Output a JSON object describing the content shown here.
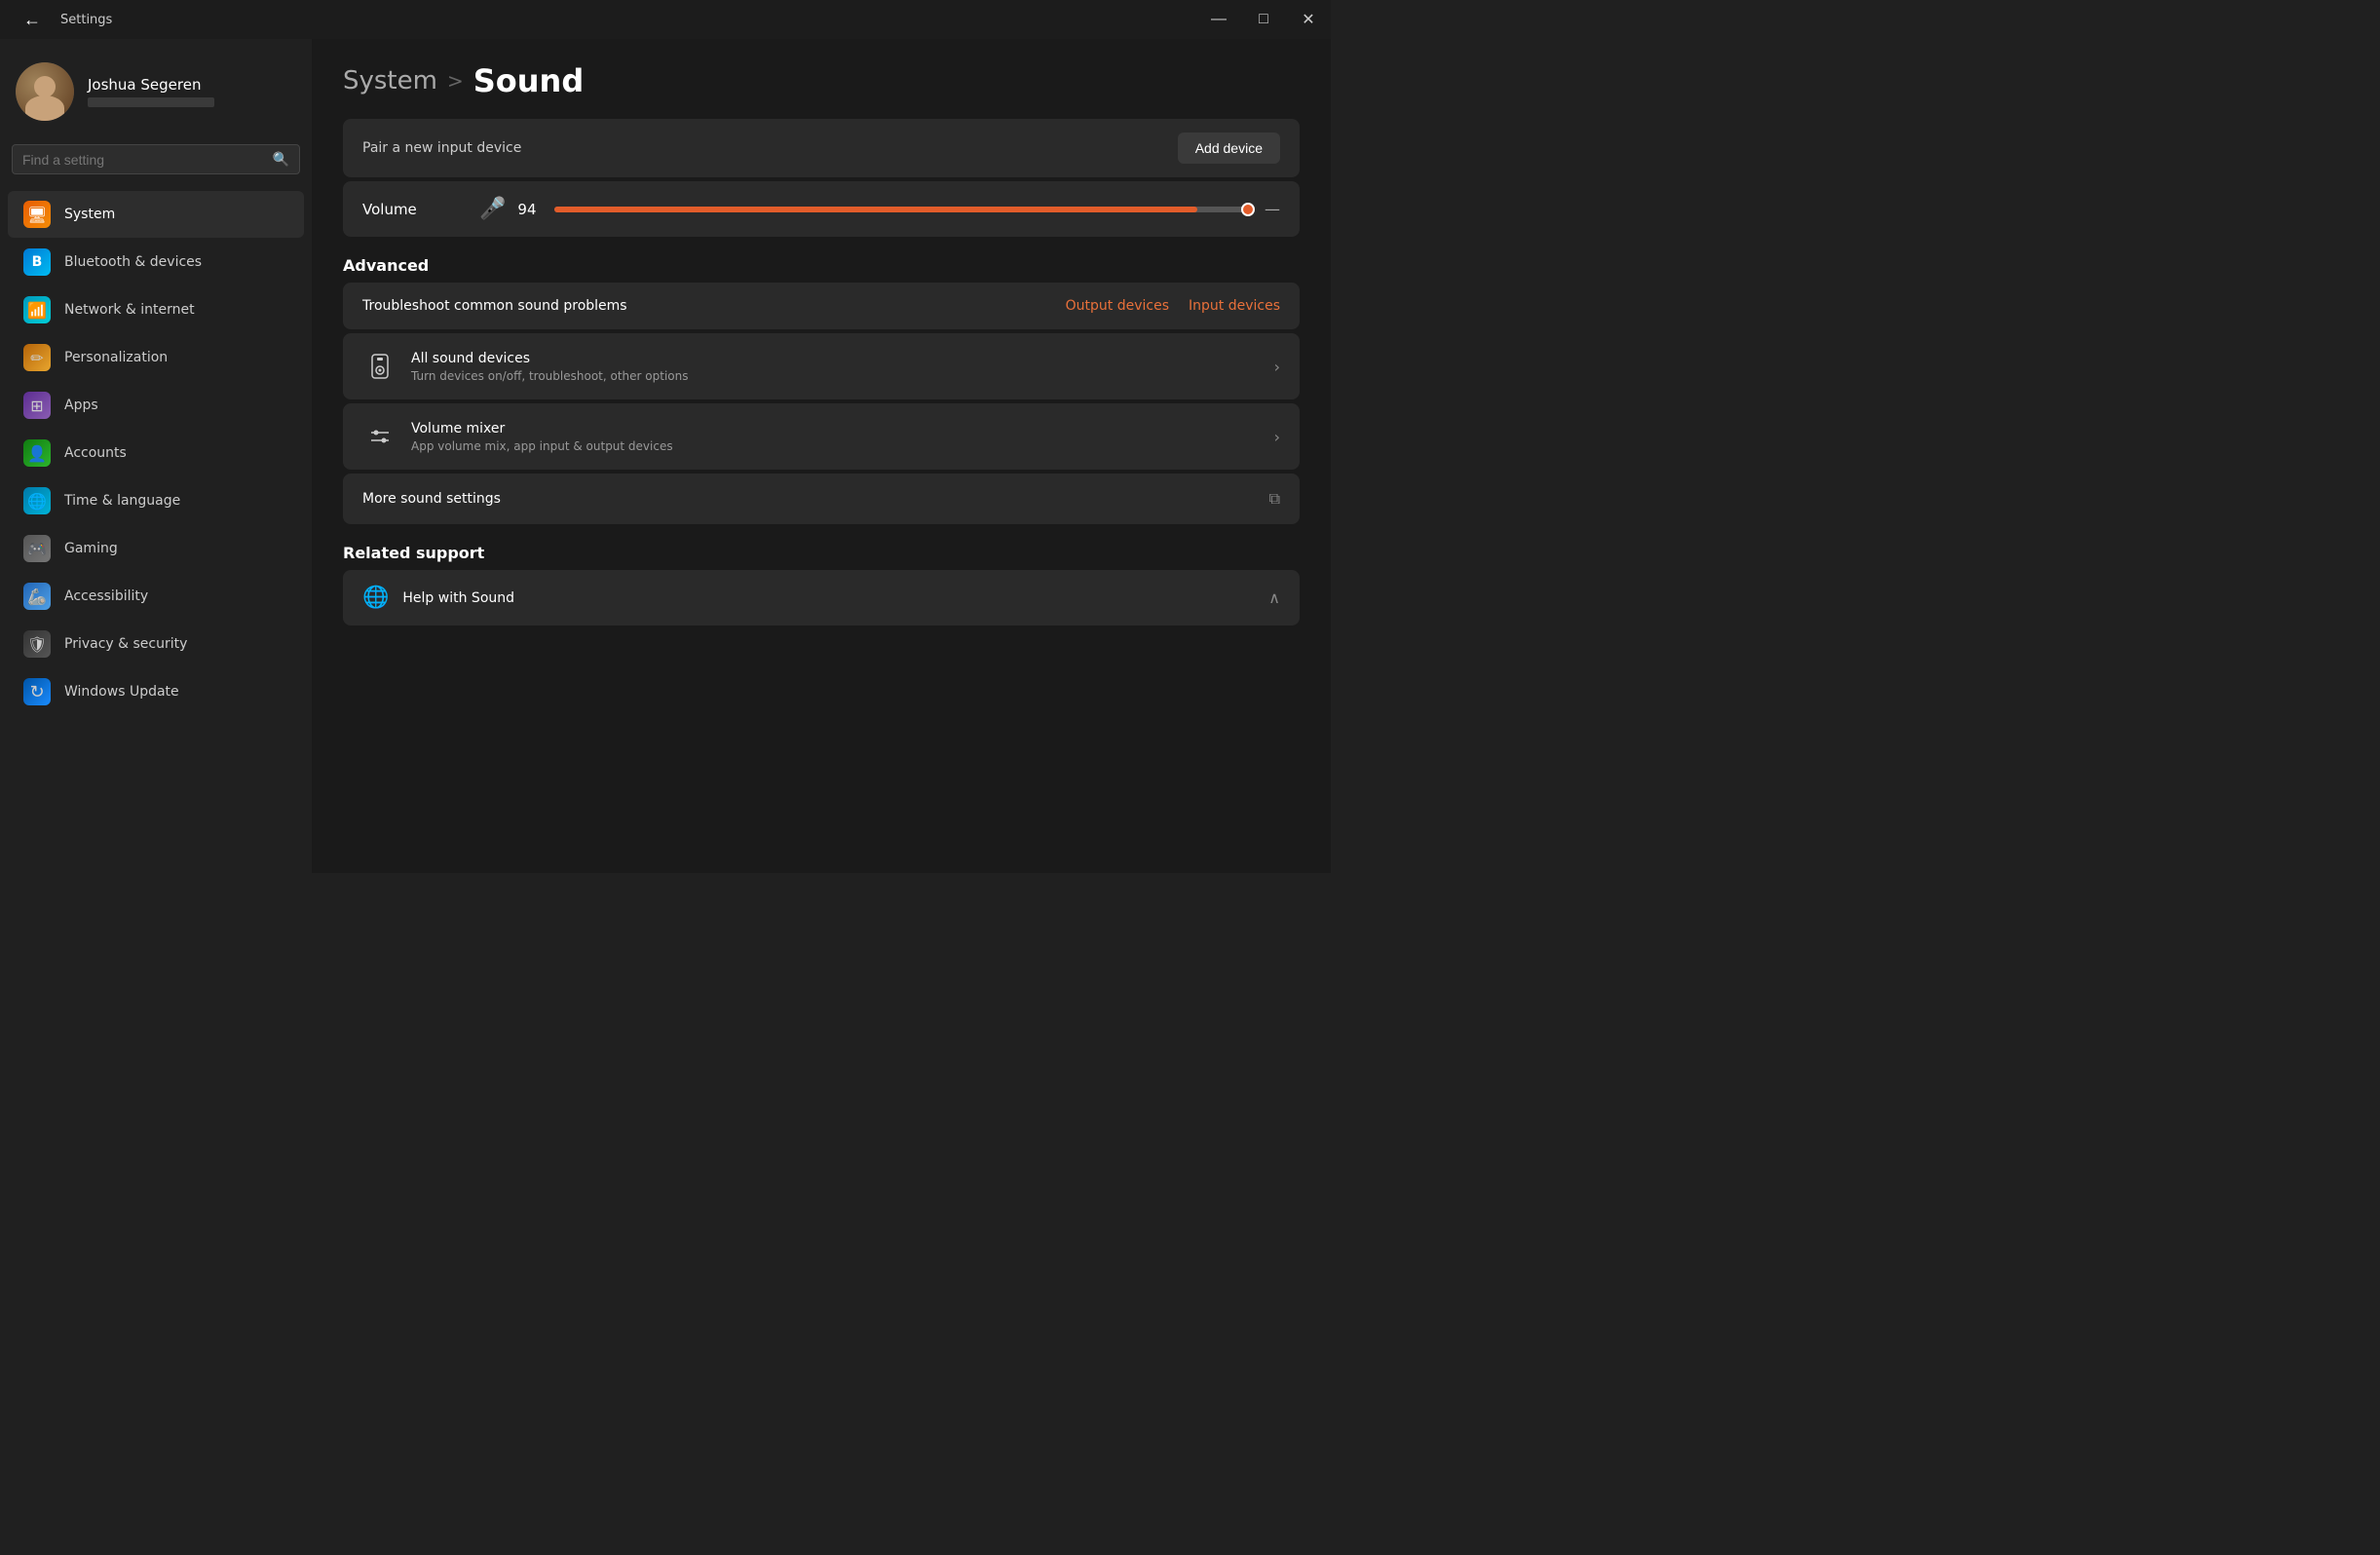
{
  "window": {
    "title": "Settings",
    "controls": {
      "minimize": "—",
      "maximize": "□",
      "close": "✕"
    }
  },
  "sidebar": {
    "user": {
      "name": "Joshua Segeren",
      "email_placeholder": "●●●●●●●●●●●●"
    },
    "search": {
      "placeholder": "Find a setting"
    },
    "nav_items": [
      {
        "id": "system",
        "label": "System",
        "icon": "🖥",
        "icon_class": "orange",
        "active": true
      },
      {
        "id": "bluetooth",
        "label": "Bluetooth & devices",
        "icon": "✦",
        "icon_class": "blue",
        "active": false
      },
      {
        "id": "network",
        "label": "Network & internet",
        "icon": "📶",
        "icon_class": "cyan",
        "active": false
      },
      {
        "id": "personalization",
        "label": "Personalization",
        "icon": "✏",
        "icon_class": "yellow",
        "active": false
      },
      {
        "id": "apps",
        "label": "Apps",
        "icon": "⊞",
        "icon_class": "purple",
        "active": false
      },
      {
        "id": "accounts",
        "label": "Accounts",
        "icon": "👤",
        "icon_class": "green",
        "active": false
      },
      {
        "id": "time",
        "label": "Time & language",
        "icon": "🌐",
        "icon_class": "teal",
        "active": false
      },
      {
        "id": "gaming",
        "label": "Gaming",
        "icon": "🎮",
        "icon_class": "game",
        "active": false
      },
      {
        "id": "accessibility",
        "label": "Accessibility",
        "icon": "♿",
        "icon_class": "access",
        "active": false
      },
      {
        "id": "privacy",
        "label": "Privacy & security",
        "icon": "🛡",
        "icon_class": "shield",
        "active": false
      },
      {
        "id": "update",
        "label": "Windows Update",
        "icon": "↻",
        "icon_class": "update",
        "active": false
      }
    ]
  },
  "content": {
    "breadcrumb_parent": "System",
    "breadcrumb_sep": ">",
    "breadcrumb_current": "Sound",
    "pair_device": {
      "label": "Pair a new input device",
      "button": "Add device"
    },
    "volume": {
      "label": "Volume",
      "value": 94,
      "percent": 92
    },
    "advanced_section": {
      "heading": "Advanced",
      "troubleshoot": {
        "label": "Troubleshoot common sound problems",
        "link1": "Output devices",
        "link2": "Input devices"
      },
      "all_sound_devices": {
        "title": "All sound devices",
        "subtitle": "Turn devices on/off, troubleshoot, other options"
      },
      "volume_mixer": {
        "title": "Volume mixer",
        "subtitle": "App volume mix, app input & output devices"
      },
      "more_sound": {
        "title": "More sound settings"
      }
    },
    "related_support": {
      "heading": "Related support",
      "help_with_sound": "Help with Sound"
    }
  }
}
